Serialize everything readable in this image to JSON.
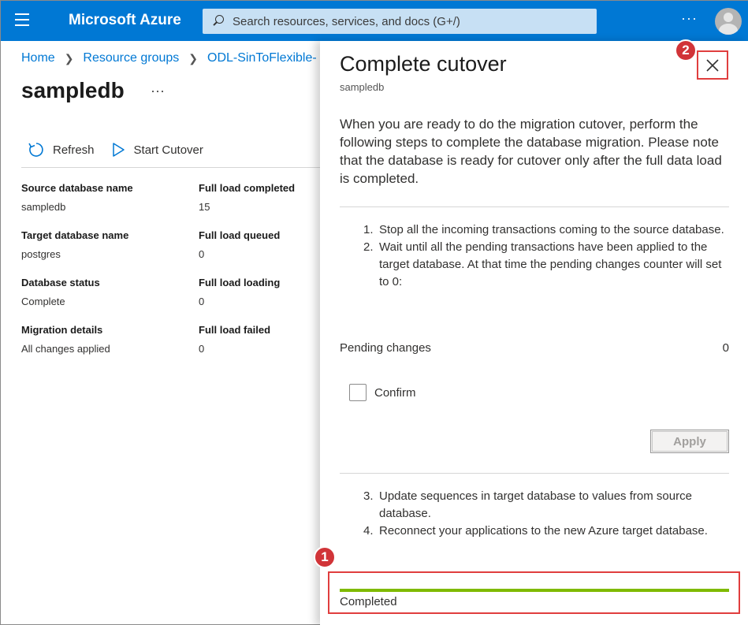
{
  "topbar": {
    "brand": "Microsoft Azure",
    "search_placeholder": "Search resources, services, and docs (G+/)",
    "more": "···"
  },
  "breadcrumb": [
    "Home",
    "Resource groups",
    "ODL-SinToFlexible-"
  ],
  "page": {
    "title": "sampledb",
    "more": "···"
  },
  "toolbar": {
    "refresh_label": "Refresh",
    "start_cutover_label": "Start Cutover"
  },
  "properties": [
    {
      "label": "Source database name",
      "value": "sampledb"
    },
    {
      "label": "Full load completed",
      "value": "15"
    },
    {
      "label": "Target database name",
      "value": "postgres"
    },
    {
      "label": "Full load queued",
      "value": "0"
    },
    {
      "label": "Database status",
      "value": "Complete"
    },
    {
      "label": "Full load loading",
      "value": "0"
    },
    {
      "label": "Migration details",
      "value": "All changes applied"
    },
    {
      "label": "Full load failed",
      "value": "0"
    }
  ],
  "panel": {
    "title": "Complete cutover",
    "subtitle": "sampledb",
    "intro": "When you are ready to do the migration cutover, perform the following steps to complete the database migration. Please note that the database is ready for cutover only after the full data load is completed.",
    "steps_a": [
      {
        "num": "1.",
        "text": "Stop all the incoming transactions coming to the source database."
      },
      {
        "num": "2.",
        "text": "Wait until all the pending transactions have been applied to the target database. At that time the pending changes counter will set to 0:"
      }
    ],
    "pending_label": "Pending changes",
    "pending_value": "0",
    "confirm_label": "Confirm",
    "apply_label": "Apply",
    "steps_b": [
      {
        "num": "3.",
        "text": "Update sequences in target database to values from source database."
      },
      {
        "num": "4.",
        "text": "Reconnect your applications to the new Azure target database."
      }
    ],
    "progress": 1.0,
    "progress_label": "Completed",
    "progress_color": "#7fba00"
  },
  "annotations": {
    "badge_1": "1",
    "badge_2": "2"
  },
  "colors": {
    "accent": "#0078d4",
    "annotation": "#d13438"
  }
}
